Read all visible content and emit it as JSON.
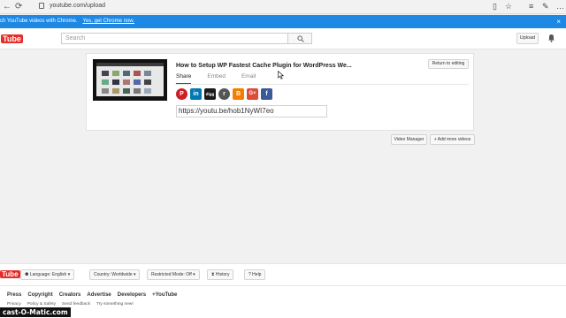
{
  "browser": {
    "url": "youtube.com/upload",
    "refresh_glyph": "⟳",
    "menu_glyph": "≡"
  },
  "banner": {
    "text": "ch YouTube videos with Chrome.",
    "link": "Yes, get Chrome now.",
    "close": "×",
    "color": "#1e88e5"
  },
  "header": {
    "logo_you": "You",
    "logo_tube": "Tube",
    "search_placeholder": "Search",
    "upload_label": "Upload"
  },
  "video": {
    "title": "How to Setup WP Fastest Cache Plugin for WordPress We...",
    "return_label": "Return to editing",
    "tabs": [
      {
        "label": "Share",
        "active": true
      },
      {
        "label": "Embed",
        "active": false
      },
      {
        "label": "Email",
        "active": false
      }
    ],
    "share_url": "https://youtu.be/hob1NyWI7eo",
    "social": [
      {
        "name": "pinterest",
        "glyph": "P",
        "color": "#cb2027"
      },
      {
        "name": "linkedin",
        "glyph": "in",
        "color": "#0077b5"
      },
      {
        "name": "digg",
        "glyph": "digg",
        "color": "#1b1b1b"
      },
      {
        "name": "reddit",
        "glyph": "r",
        "color": "#555555"
      },
      {
        "name": "blogger",
        "glyph": "B",
        "color": "#f57d00"
      },
      {
        "name": "google-plus",
        "glyph": "G+",
        "color": "#dd4b39"
      },
      {
        "name": "facebook",
        "glyph": "f",
        "color": "#3b5998"
      }
    ]
  },
  "actions": {
    "video_manager": "Video Manager",
    "add_more": "+ Add more videos"
  },
  "footer": {
    "logo": "Tube",
    "language": "Language: English",
    "country": "Country: Worldwide",
    "restricted": "Restricted Mode: Off",
    "history": "History",
    "help": "Help",
    "links": [
      "Press",
      "Copyright",
      "Creators",
      "Advertise",
      "Developers",
      "+YouTube"
    ],
    "links2": [
      "Privacy",
      "Policy & Safety",
      "Send feedback",
      "Try something new!"
    ]
  },
  "watermark": "cast-O-Matic.com",
  "colors": {
    "brand_red": "#e52d27",
    "active_tab": "#cc181e"
  }
}
